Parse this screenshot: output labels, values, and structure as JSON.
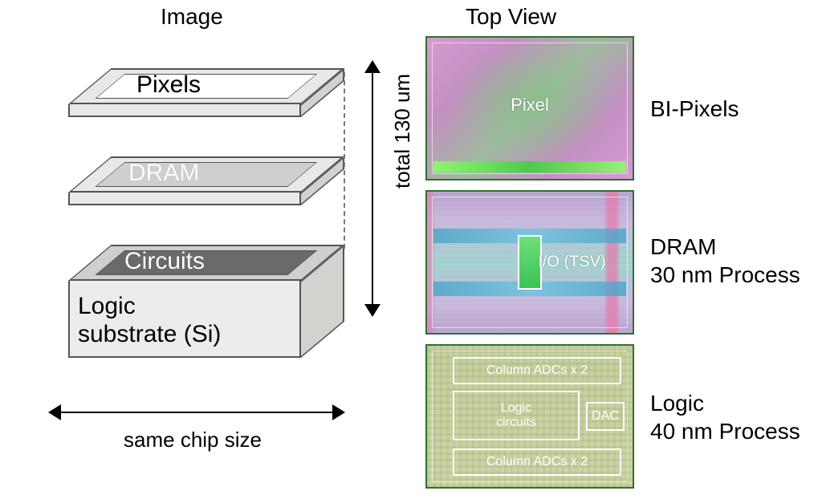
{
  "titles": {
    "left": "Image",
    "right": "Top View"
  },
  "layers": {
    "pixels": "Pixels",
    "dram": "DRAM",
    "circuits": "Circuits",
    "substrate": "Logic\nsubstrate (Si)"
  },
  "left_dims": {
    "width_caption": "same chip size",
    "height_caption": "total 130 um"
  },
  "right_panels": {
    "pixel": {
      "overlay": "Pixel",
      "side": "BI-Pixels"
    },
    "dram": {
      "overlay": "I/O (TSV)",
      "side": "DRAM\n30 nm Process"
    },
    "logic": {
      "overlay_top": "Column ADCs x 2",
      "overlay_mid": "Logic\ncircuits",
      "overlay_dac": "DAC",
      "overlay_bot": "Column ADCs x 2",
      "side": "Logic\n40 nm Process"
    }
  }
}
